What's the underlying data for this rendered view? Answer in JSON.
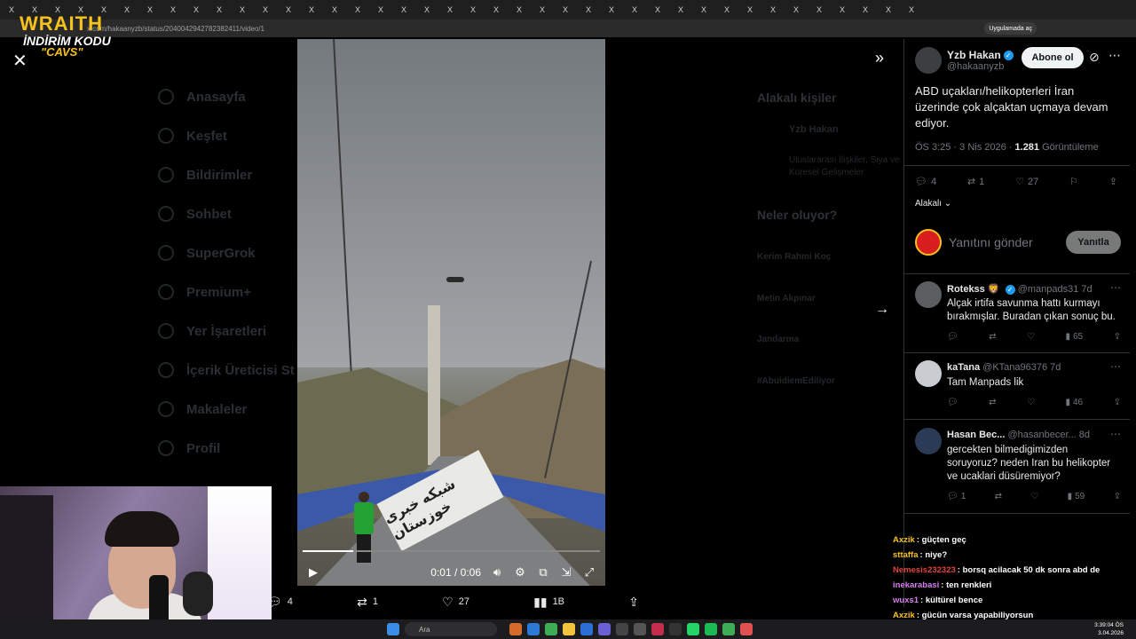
{
  "browser": {
    "url": "x.com/hakaanyzb/status/2040042942782382411/video/1",
    "open_in_app": "Uygulamada aç",
    "tab_glyph": "X",
    "tab_count": 40
  },
  "stream_overlay": {
    "brand": "WRAITH",
    "promo_line": "İNDİRİM KODU",
    "promo_code": "\"CAVS\""
  },
  "backdrop_nav": {
    "items": [
      "Anasayfa",
      "Keşfet",
      "Bildirimler",
      "Sohbet",
      "SuperGrok",
      "Premium+",
      "Yer İşaretleri",
      "İçerik Üreticisi St",
      "Makaleler",
      "Profil"
    ]
  },
  "backdrop_right": {
    "related_title": "Alakalı kişiler",
    "related_name": "Yzb Hakan",
    "related_bio": "Uluslararası İlişkiler, Siya ve Küresel Gelişmeler",
    "trends_title": "Neler oluyor?",
    "trends": [
      "Kerim Rahmi Koç",
      "Metin Akpınar",
      "Jandarma",
      "#AbuidiemEdiliyor"
    ]
  },
  "video": {
    "time_current": "0:01",
    "time_total": "0:06",
    "time_separator": " / ",
    "progress": 0.17,
    "sign_text": "شبکه خبری خوزستان"
  },
  "video_actions": {
    "replies": "4",
    "reposts": "1",
    "likes": "27",
    "views": "1B"
  },
  "tweet": {
    "author_name": "Yzb Hakan",
    "author_handle": "@hakaanyzb",
    "follow_label": "Abone ol",
    "text": "ABD uçakları/helikopterleri İran üzerinde çok alçaktan uçmaya devam ediyor.",
    "time": "ÖS 3:25",
    "date": "3 Nis 2026",
    "views_count": "1.281",
    "views_label": "Görüntüleme",
    "meta_sep": " · ",
    "replies": "4",
    "reposts": "1",
    "likes": "27",
    "sort_label": "Alakalı"
  },
  "reply_compose": {
    "placeholder": "Yanıtını gönder",
    "button": "Yanıtla"
  },
  "replies": [
    {
      "name": "Rotekss 🦁",
      "handle": "@manpads31",
      "age": "7d",
      "text": "Alçak irtifa savunma hattı kurmayı bırakmışlar. Buradan çıkan sonuç bu.",
      "replies": "",
      "reposts": "",
      "likes": "",
      "views": "65"
    },
    {
      "name": "kaTana",
      "handle": "@KTana96376",
      "age": "7d",
      "text": "Tam Manpads lik",
      "replies": "",
      "reposts": "",
      "likes": "",
      "views": "46"
    },
    {
      "name": "Hasan Bec...",
      "handle": "@hasanbecer...",
      "age": "8d",
      "text": "gercekten bilmedigimizden soruyoruz? neden Iran bu helikopter ve ucaklari düsüremiyor?",
      "replies": "1",
      "reposts": "",
      "likes": "",
      "views": "59"
    }
  ],
  "chat": [
    {
      "user": "Axzik",
      "color": "#f7c21b",
      "msg": "güçten geç"
    },
    {
      "user": "sttaffa",
      "color": "#f7c21b",
      "msg": "niye?"
    },
    {
      "user": "Nemesis232323",
      "color": "#e0443a",
      "msg": "borsq acilacak 50 dk sonra abd de"
    },
    {
      "user": "inekarabasi",
      "color": "#d77bf0",
      "msg": "ten renkleri"
    },
    {
      "user": "wuxs1",
      "color": "#d77bf0",
      "msg": "kültürel bence"
    },
    {
      "user": "Axzik",
      "color": "#f7c21b",
      "msg": "gücün varsa yapabiliyorsun"
    }
  ],
  "taskbar": {
    "search_label": "Ara",
    "clock_time": "3:39:04 ÖS",
    "clock_date": "3.04.2026"
  }
}
